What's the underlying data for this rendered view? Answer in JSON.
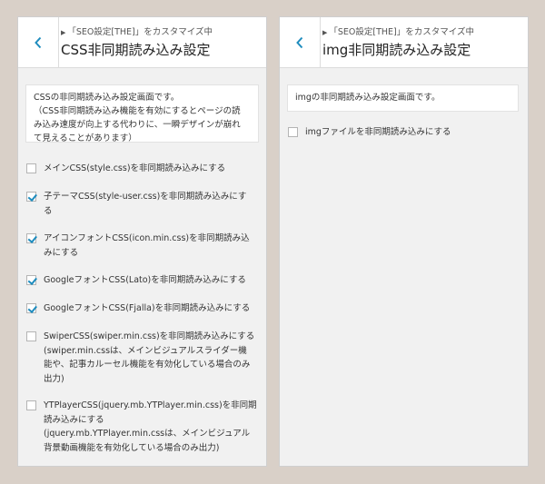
{
  "left_panel": {
    "breadcrumb": "「SEO設定[THE]」をカスタマイズ中",
    "title": "CSS非同期読み込み設定",
    "description": [
      "CSSの非同期読み込み設定画面です。",
      "（CSS非同期読み込み機能を有効にするとページの読",
      "み込み速度が向上する代わりに、一瞬デザインが崩れ",
      "て見えることがあります）"
    ],
    "options": [
      {
        "checked": false,
        "lines": [
          "メインCSS(style.css)を非同期読み込みにする"
        ]
      },
      {
        "checked": true,
        "lines": [
          "子テーマCSS(style-user.css)を非同期読み込みにす",
          "る"
        ]
      },
      {
        "checked": true,
        "lines": [
          "アイコンフォントCSS(icon.min.css)を非同期読み込",
          "みにする"
        ]
      },
      {
        "checked": true,
        "lines": [
          "GoogleフォントCSS(Lato)を非同期読み込みにする"
        ]
      },
      {
        "checked": true,
        "lines": [
          "GoogleフォントCSS(Fjalla)を非同期読み込みにする"
        ]
      },
      {
        "checked": false,
        "lines": [
          "SwiperCSS(swiper.min.css)を非同期読み込みにする",
          "(swiper.min.cssは、メインビジュアルスライダー機",
          "能や、記事カルーセル機能を有効化している場合のみ",
          "出力)"
        ]
      },
      {
        "checked": false,
        "lines": [
          "YTPlayerCSS(jquery.mb.YTPlayer.min.css)を非同期",
          "読み込みにする",
          "(jquery.mb.YTPlayer.min.cssは、メインビジュアル",
          "背景動画機能を有効化している場合のみ出力)"
        ]
      }
    ]
  },
  "right_panel": {
    "breadcrumb": "「SEO設定[THE]」をカスタマイズ中",
    "title": "img非同期読み込み設定",
    "description": [
      "imgの非同期読み込み設定画面です。"
    ],
    "options": [
      {
        "checked": false,
        "lines": [
          "imgファイルを非同期読み込みにする"
        ]
      }
    ]
  },
  "colors": {
    "background": "#d9d0c8",
    "panel": "#f1f1f1",
    "accent": "#1e8cbe"
  },
  "icons": {
    "back": "chevron-left-icon",
    "breadcrumb": "caret-right-icon",
    "checkbox": "checkmark-icon"
  }
}
